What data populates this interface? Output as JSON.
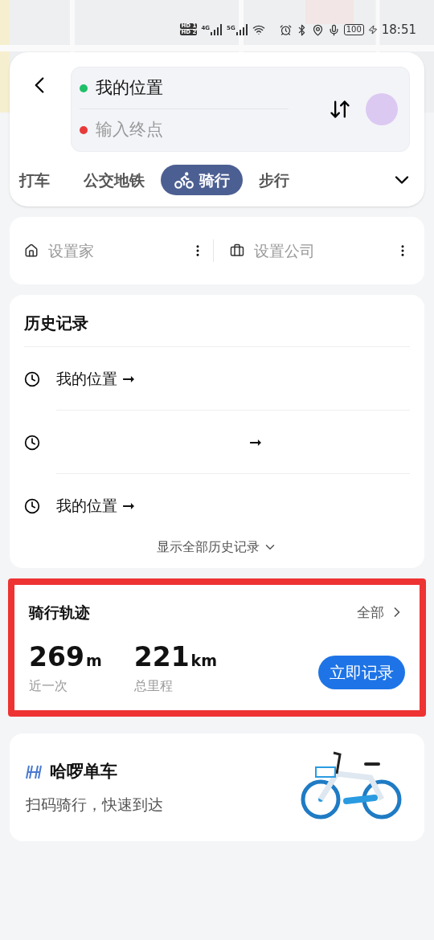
{
  "status_bar": {
    "sim_labels": [
      "HD 1",
      "HD 2"
    ],
    "networks": [
      "4G",
      "5G"
    ],
    "battery": "100",
    "time": "18:51"
  },
  "route": {
    "origin": "我的位置",
    "destination_placeholder": "输入终点"
  },
  "modes": [
    {
      "label": "打车",
      "selected": false
    },
    {
      "label": "公交地铁",
      "selected": false
    },
    {
      "label": "骑行",
      "selected": true
    },
    {
      "label": "步行",
      "selected": false
    }
  ],
  "shortcuts": [
    {
      "kind": "home",
      "label": "设置家"
    },
    {
      "kind": "work",
      "label": "设置公司"
    }
  ],
  "history": {
    "title": "历史记录",
    "items": [
      {
        "from": "我的位置",
        "arrow": "➞"
      },
      {
        "arrow": "➞"
      },
      {
        "from": "我的位置",
        "arrow": "➞"
      }
    ],
    "show_all": "显示全部历史记录"
  },
  "ride_track": {
    "highlighted": true,
    "title": "骑行轨迹",
    "all_link": "全部",
    "stats": [
      {
        "value": "269",
        "unit": "m",
        "label": "近一次"
      },
      {
        "value": "221",
        "unit": "km",
        "label": "总里程"
      }
    ],
    "record_button": "立即记录"
  },
  "promo": {
    "title": "哈啰单车",
    "subtitle": "扫码骑行，快速到达"
  }
}
